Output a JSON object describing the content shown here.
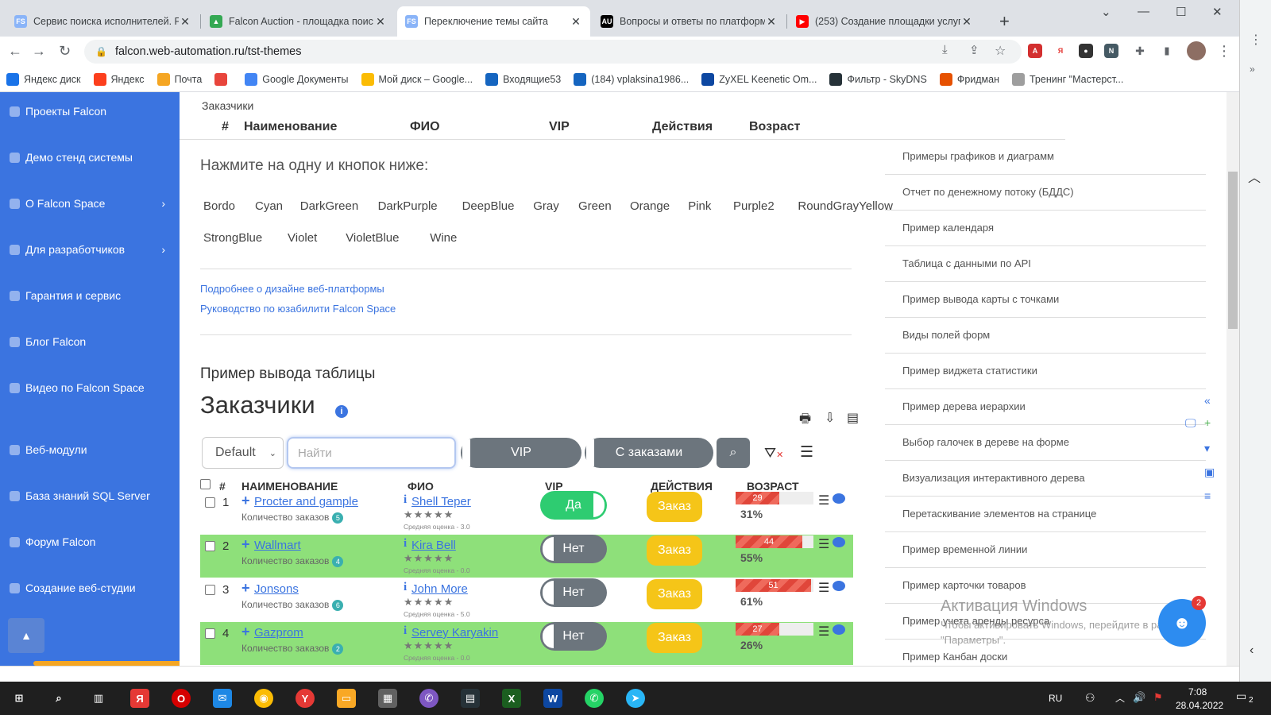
{
  "browser": {
    "tabs": [
      {
        "title": "Сервис поиска исполнителей. F",
        "favicon": "FS",
        "color": "#8ab4f8"
      },
      {
        "title": "Falcon Auction - площадка поис",
        "favicon": "▲",
        "color": "#34a853"
      },
      {
        "title": "Переключение темы сайта",
        "favicon": "FS",
        "color": "#8ab4f8",
        "active": true
      },
      {
        "title": "Вопросы и ответы по платформ",
        "favicon": "AU",
        "color": "#000000"
      },
      {
        "title": "(253) Создание площадки услуг",
        "favicon": "▶",
        "color": "#ff0000"
      }
    ],
    "url": "falcon.web-automation.ru/tst-themes",
    "bookmarks": [
      {
        "label": "Яндекс диск",
        "color": "#1a73e8"
      },
      {
        "label": "Яндекс",
        "color": "#fc3f1d"
      },
      {
        "label": "Почта",
        "color": "#f5a623"
      },
      {
        "label": "",
        "color": "#e8453c"
      },
      {
        "label": "Google Документы",
        "color": "#4285f4"
      },
      {
        "label": "Мой диск – Google...",
        "color": "#fbbc04"
      },
      {
        "label": "Входящие53",
        "color": "#1565c0"
      },
      {
        "label": "(184) vplaksina1986...",
        "color": "#1565c0"
      },
      {
        "label": "ZyXEL Keenetic Om...",
        "color": "#0d47a1"
      },
      {
        "label": "Фильтр - SkyDNS",
        "color": "#263238"
      },
      {
        "label": "Фридман",
        "color": "#e65100"
      },
      {
        "label": "Тренинг \"Мастерст...",
        "color": "#9e9e9e"
      }
    ]
  },
  "sidebar": {
    "items": [
      {
        "label": "Проекты Falcon",
        "chevron": false
      },
      {
        "label": "Демо стенд системы",
        "chevron": false
      },
      {
        "label": "О Falcon Space",
        "chevron": true
      },
      {
        "label": "Для разработчиков",
        "chevron": true
      },
      {
        "label": "Гарантия и сервис",
        "chevron": false
      },
      {
        "label": "Блог Falcon",
        "chevron": false
      },
      {
        "label": "Видео по Falcon Space",
        "chevron": false
      },
      {
        "label": "Веб-модули",
        "chevron": false
      },
      {
        "label": "База знаний SQL Server",
        "chevron": false
      },
      {
        "label": "Форум Falcon",
        "chevron": false
      },
      {
        "label": "Создание веб-студии",
        "chevron": false
      }
    ]
  },
  "sticky": {
    "title": "Заказчики",
    "cols": [
      "#",
      "Наименование",
      "ФИО",
      "VIP",
      "Действия",
      "Возраст"
    ]
  },
  "themes": {
    "prompt": "Нажмите на одну и кнопок ниже:",
    "row1": [
      "Bordo",
      "Cyan",
      "DarkGreen",
      "DarkPurple",
      "DeepBlue",
      "Gray",
      "Green",
      "Orange",
      "Pink",
      "Purple2",
      "RoundGrayYellow"
    ],
    "row2": [
      "StrongBlue",
      "Violet",
      "VioletBlue",
      "Wine"
    ]
  },
  "links": [
    "Подробнее о дизайне веб-платформы",
    "Руководство по юзабилити Falcon Space"
  ],
  "table": {
    "subtitle": "Пример вывода таблицы",
    "title": "Заказчики",
    "select": "Default",
    "search_placeholder": "Найти",
    "toggle_vip": "VIP",
    "toggle_orders": "С заказами",
    "headers": [
      "#",
      "НАИМЕНОВАНИЕ",
      "ФИО",
      "VIP",
      "ДЕЙСТВИЯ",
      "ВОЗРАСТ"
    ],
    "order_label": "Количество заказов",
    "rating_label": "Средняя оценка",
    "action_label": "Заказ",
    "rows": [
      {
        "num": "1",
        "name": "Procter and gample",
        "orders": "5",
        "person": "Shell Teper",
        "rating": "3.0",
        "vip": "Да",
        "vip_on": true,
        "age": 29,
        "pct": "31%",
        "green": false
      },
      {
        "num": "2",
        "name": "Wallmart",
        "orders": "4",
        "person": "Kira Bell",
        "rating": "0.0",
        "vip": "Нет",
        "vip_on": false,
        "age": 44,
        "pct": "55%",
        "green": true
      },
      {
        "num": "3",
        "name": "Jonsons",
        "orders": "6",
        "person": "John More",
        "rating": "5.0",
        "vip": "Нет",
        "vip_on": false,
        "age": 51,
        "pct": "61%",
        "green": false
      },
      {
        "num": "4",
        "name": "Gazprom",
        "orders": "2",
        "person": "Servey Karyakin",
        "rating": "0.0",
        "vip": "Нет",
        "vip_on": false,
        "age": 27,
        "pct": "26%",
        "green": true
      }
    ]
  },
  "right_menu": [
    "Примеры графиков и диаграмм",
    "Отчет по денежному потоку (БДДС)",
    "Пример календаря",
    "Таблица с данными по API",
    "Пример вывода карты с точками",
    "Виды полей форм",
    "Пример виджета статистики",
    "Пример дерева иерархии",
    "Выбор галочек в дереве на форме",
    "Визуализация интерактивного дерева",
    "Перетаскивание элементов на странице",
    "Пример временной линии",
    "Пример карточки товаров",
    "Пример учета аренды ресурса",
    "Пример Канбан доски"
  ],
  "windows_activation": {
    "line1": "Активация Windows",
    "line2": "Чтобы активировать Windows, перейдите в раздел",
    "line3": "\"Параметры\"."
  },
  "chat_badge": "2",
  "taskbar": {
    "lang": "RU",
    "time": "7:08",
    "date": "28.04.2022",
    "notif": "2"
  }
}
